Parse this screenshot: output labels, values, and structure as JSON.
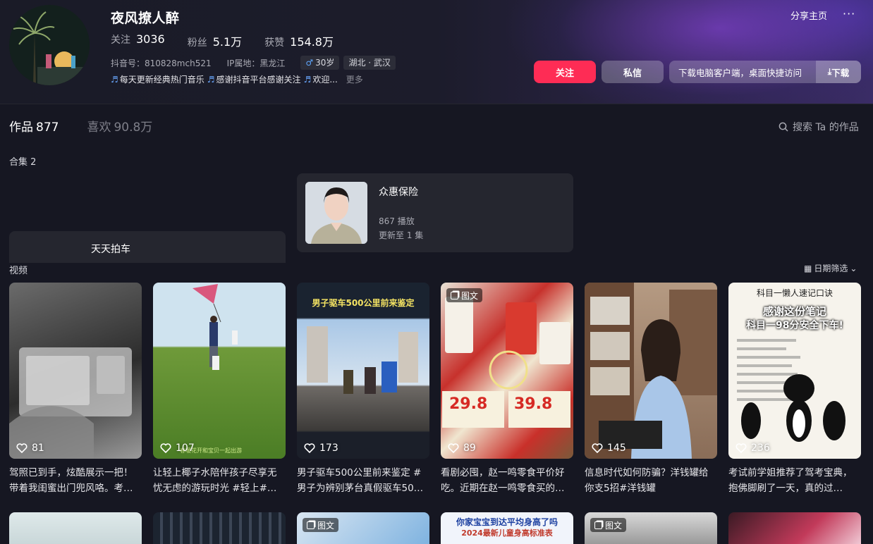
{
  "profile": {
    "name": "夜风撩人醉",
    "stats": [
      {
        "label": "关注",
        "value": "3036"
      },
      {
        "label": "粉丝",
        "value": "5.1万"
      },
      {
        "label": "获赞",
        "value": "154.8万"
      }
    ],
    "douyin_id": "抖音号：810828mch521",
    "ip": "IP属地：黑龙江",
    "age": "30岁",
    "location": "湖北 · 武汉",
    "bio_segments": [
      "每天更新经典热门音乐",
      "感谢抖音平台感谢关注",
      "欢迎..."
    ],
    "bio_more": "更多",
    "male_symbol": "♂"
  },
  "header_actions": {
    "share": "分享主页",
    "more": "···",
    "follow": "关注",
    "message": "私信",
    "download_text": "下载电脑客户端，桌面快捷访问",
    "download_action": "下载"
  },
  "tabs": [
    {
      "label": "作品",
      "count": "877"
    },
    {
      "label": "喜欢",
      "count": "90.8万"
    }
  ],
  "search": {
    "label": "搜索 Ta 的作品"
  },
  "collections": {
    "label": "合集 2",
    "items": [
      {
        "title": "天天拍车"
      },
      {
        "title": "众惠保险",
        "plays": "867 播放",
        "updated": "更新至 1 集"
      }
    ]
  },
  "videos": {
    "label": "视频",
    "filter": "日期筛选",
    "items": [
      {
        "likes": "81",
        "caption": "驾照已到手，炫酷展示一把！带着我闺蜜出门兜风咯。考…",
        "badge": ""
      },
      {
        "likes": "107",
        "caption": "让轻上椰子水陪伴孩子尽享无忧无虑的游玩时光 #轻上#…",
        "badge": "",
        "overlay": "春暖花开和宝贝一起出游"
      },
      {
        "likes": "173",
        "caption": "男子驱车500公里前来鉴定 #男子为辨别茅台真假驱车50…",
        "badge": "",
        "overlay": "男子驱车500公里前来鉴定"
      },
      {
        "likes": "89",
        "caption": "看剧必囤，赵一鸣零食平价好吃。近期在赵一鸣零食买的…",
        "badge": "图文",
        "overlay": "29.8",
        "overlay2": "39.8"
      },
      {
        "likes": "145",
        "caption": "信息时代如何防骗？洋钱罐给你支5招#洋钱罐",
        "badge": ""
      },
      {
        "likes": "236",
        "caption": "考试前学姐推荐了驾考宝典，抱佛脚刷了一天，真的过…",
        "badge": "",
        "overlay": "科目一懒人速记口诀",
        "overlay2": "感谢这份笔记",
        "overlay3": "科目一98分安全下车!"
      }
    ],
    "row2": [
      {
        "badge": ""
      },
      {
        "badge": ""
      },
      {
        "badge": "图文"
      },
      {
        "badge": "",
        "overlay": "你家宝宝到达平均身高了吗",
        "overlay2": "2024最新儿童身高标准表"
      },
      {
        "badge": "图文"
      },
      {
        "badge": ""
      }
    ]
  }
}
